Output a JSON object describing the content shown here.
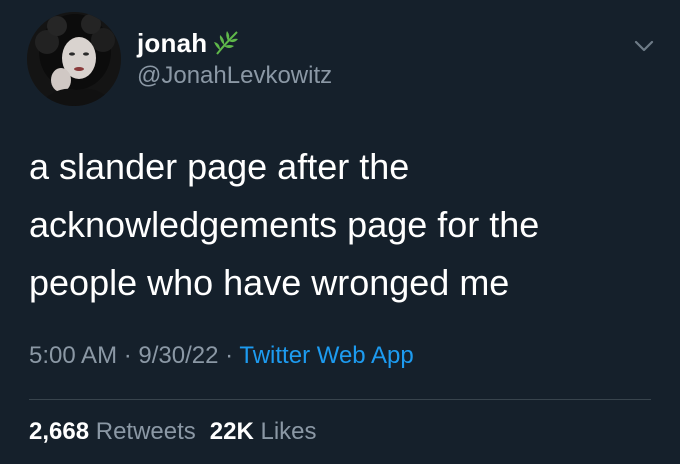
{
  "user": {
    "display_name": "jonah",
    "handle": "@JonahLevkowitz",
    "badge_icon": "herb-leaf-icon"
  },
  "tweet": {
    "lines": [
      "a slander page after the",
      "acknowledgements page for the",
      "people who have wronged me"
    ],
    "time": "5:00 AM",
    "date": "9/30/22",
    "separator": "·",
    "source": "Twitter Web App"
  },
  "stats": {
    "retweets_count": "2,668",
    "retweets_label": "Retweets",
    "likes_count": "22K",
    "likes_label": "Likes"
  },
  "colors": {
    "background": "#15202b",
    "text": "#ffffff",
    "secondary": "#8b98a5",
    "link": "#1d9bf0",
    "divider": "#38444d",
    "leaf": "#5fb84a"
  },
  "icons": {
    "menu": "chevron-down-icon"
  }
}
